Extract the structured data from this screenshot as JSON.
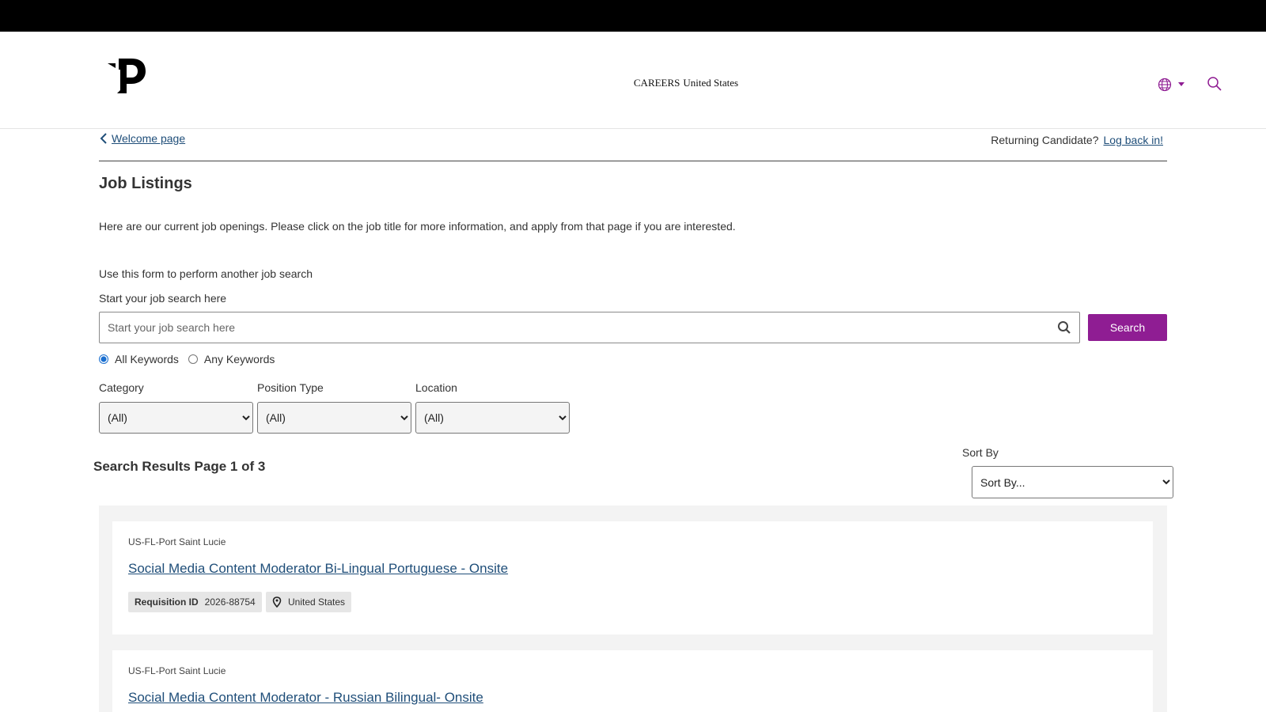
{
  "header": {
    "title_part1": "CAREERS",
    "title_part2": "United States"
  },
  "nav": {
    "back_label": "Welcome page",
    "returning_text": "Returning Candidate?",
    "login_link": "Log back in!"
  },
  "page": {
    "title": "Job Listings",
    "intro": "Here are our current job openings. Please click on the job title for more information, and apply from that page if you are interested."
  },
  "search": {
    "form_intro": "Use this form to perform another job search",
    "label": "Start your job search here",
    "placeholder": "Start your job search here",
    "value": "",
    "button_label": "Search",
    "radio_all": "All Keywords",
    "radio_any": "Any Keywords",
    "selected_radio": "all"
  },
  "filters": {
    "category_label": "Category",
    "category_value": "(All)",
    "position_type_label": "Position Type",
    "position_type_value": "(All)",
    "location_label": "Location",
    "location_value": "(All)"
  },
  "results": {
    "title": "Search Results Page 1 of 3",
    "sort_label": "Sort By",
    "sort_value": "Sort By...",
    "jobs": [
      {
        "location": "US-FL-Port Saint Lucie",
        "title": "Social Media Content Moderator Bi-Lingual Portuguese - Onsite",
        "requisition_label": "Requisition ID",
        "requisition_id": "2026-88754",
        "country": "United States"
      },
      {
        "location": "US-FL-Port Saint Lucie",
        "title": "Social Media Content Moderator - Russian Bilingual- Onsite"
      }
    ]
  },
  "colors": {
    "accent": "#8f1d93",
    "link": "#1f4e79",
    "top_bar": "#000000"
  }
}
